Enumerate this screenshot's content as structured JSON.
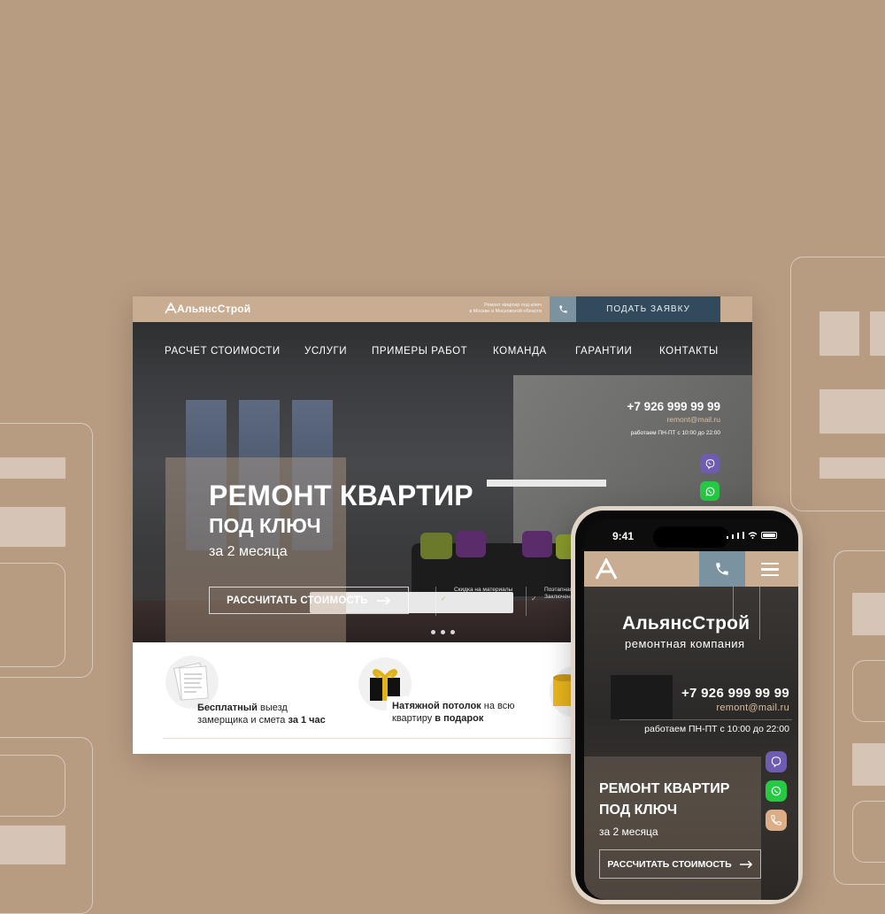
{
  "brand": {
    "name": "АльянсСтрой",
    "tagline_line1": "Ремонт квартир под ключ",
    "tagline_line2": "в Москве и Московской области",
    "mobile_subtitle": "ремонтная компания",
    "accent_color": "#c8ad92",
    "dark_color": "#324b5c"
  },
  "header": {
    "apply_label": "ПОДАТЬ ЗАЯВКУ",
    "phone_icon": "phone-icon"
  },
  "nav": {
    "items": [
      {
        "label": "РАСЧЕТ СТОИМОСТИ"
      },
      {
        "label": "УСЛУГИ"
      },
      {
        "label": "ПРИМЕРЫ РАБОТ"
      },
      {
        "label": "КОМАНДА"
      },
      {
        "label": "ГАРАНТИИ"
      },
      {
        "label": "КОНТАКТЫ"
      }
    ]
  },
  "contacts": {
    "phone": "+7 926 999 99 99",
    "email": "remont@mail.ru",
    "hours": "работаем ПН-ПТ с 10:00 до 22:00"
  },
  "messengers": [
    "viber-icon",
    "whatsapp-icon",
    "call-icon"
  ],
  "hero": {
    "title": "РЕМОНТ КВАРТИР",
    "subtitle": "ПОД КЛЮЧ",
    "term": "за 2 месяца",
    "cta_label": "РАССЧИТАТЬ СТОИМОСТЬ",
    "perks": [
      {
        "line1": "Скидка на материалы",
        "line2": "по сотрудничеству с",
        "line3": "партнерами"
      },
      {
        "line1": "Поэтапная оплата.",
        "line2": "Заключение договора",
        "line3": ""
      }
    ],
    "slides_count": 3
  },
  "features": [
    {
      "bold1": "Бесплатный",
      "text1": " выезд",
      "text2": "замерщика и смета ",
      "bold2": "за 1 час"
    },
    {
      "bold1": "Натяжной потолок",
      "text1": " на всю",
      "text2": "квартиру ",
      "bold2": "в подарок"
    }
  ],
  "mobile": {
    "time": "9:41",
    "title": "РЕМОНТ КВАРТИР",
    "subtitle": "ПОД КЛЮЧ",
    "term": "за 2 месяца",
    "cta_label": "РАССЧИТАТЬ СТОИМОСТЬ"
  }
}
